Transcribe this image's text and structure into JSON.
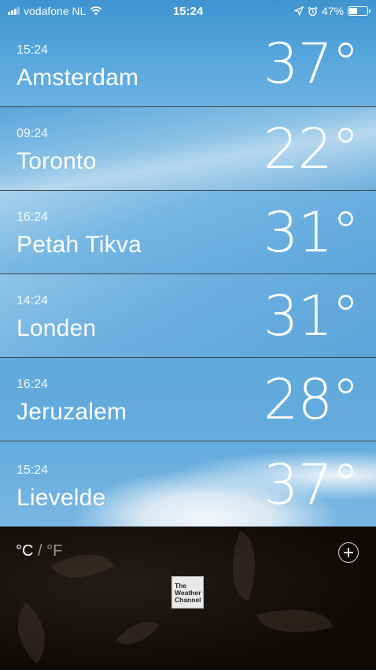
{
  "status_bar": {
    "carrier": "vodafone NL",
    "time": "15:24",
    "battery": "47%",
    "battery_level": 0.47,
    "icons": [
      "signal-icon",
      "wifi-icon",
      "location-icon",
      "alarm-icon",
      "battery-icon"
    ]
  },
  "cities": [
    {
      "time": "15:24",
      "name": "Amsterdam",
      "temp": "37°"
    },
    {
      "time": "09:24",
      "name": "Toronto",
      "temp": "22°"
    },
    {
      "time": "16:24",
      "name": "Petah Tikva",
      "temp": "31°"
    },
    {
      "time": "14:24",
      "name": "Londen",
      "temp": "31°"
    },
    {
      "time": "16:24",
      "name": "Jeruzalem",
      "temp": "28°"
    },
    {
      "time": "15:24",
      "name": "Lievelde",
      "temp": "37°"
    }
  ],
  "footer": {
    "unit_c": "°C",
    "unit_sep": " / ",
    "unit_f": "°F",
    "logo_text": "The Weather Channel",
    "logo_lines": [
      "The",
      "Weather",
      "Channel"
    ]
  },
  "colors": {
    "sky_top": "#4f9fd4",
    "sky_bottom": "#6bb3e0",
    "footer_bg": "#0d0a08"
  }
}
